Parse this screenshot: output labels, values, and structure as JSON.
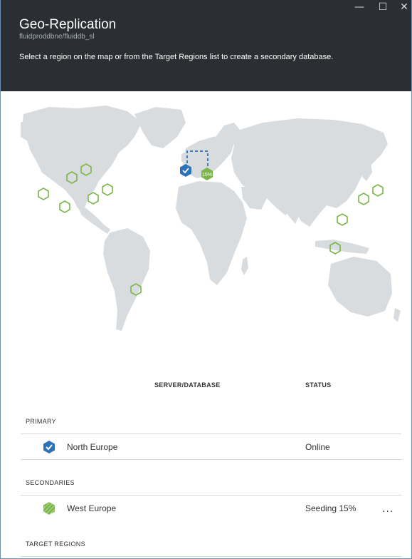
{
  "header": {
    "title": "Geo-Replication",
    "subtitle": "fluidproddbne/fluiddb_sl",
    "description": "Select a region on the map or from the Target Regions list to create a secondary database.",
    "window_controls": {
      "minimize": "—",
      "maximize": "☐",
      "close": "✕"
    }
  },
  "map": {
    "seeding_label": "15%",
    "colors": {
      "land": "#d9dcdf",
      "primary": "#2b72b8",
      "secondary": "#7ab648",
      "link": "#2b72b8"
    }
  },
  "table": {
    "col_server": "SERVER/DATABASE",
    "col_status": "STATUS",
    "primary_heading": "PRIMARY",
    "primary_row": {
      "name": "North Europe",
      "status": "Online",
      "icon": "check-hex-icon"
    },
    "secondaries_heading": "SECONDARIES",
    "secondary_row": {
      "name": "West Europe",
      "status": "Seeding 15%",
      "icon": "striped-hex-icon",
      "more": "..."
    },
    "target_heading": "TARGET REGIONS"
  }
}
